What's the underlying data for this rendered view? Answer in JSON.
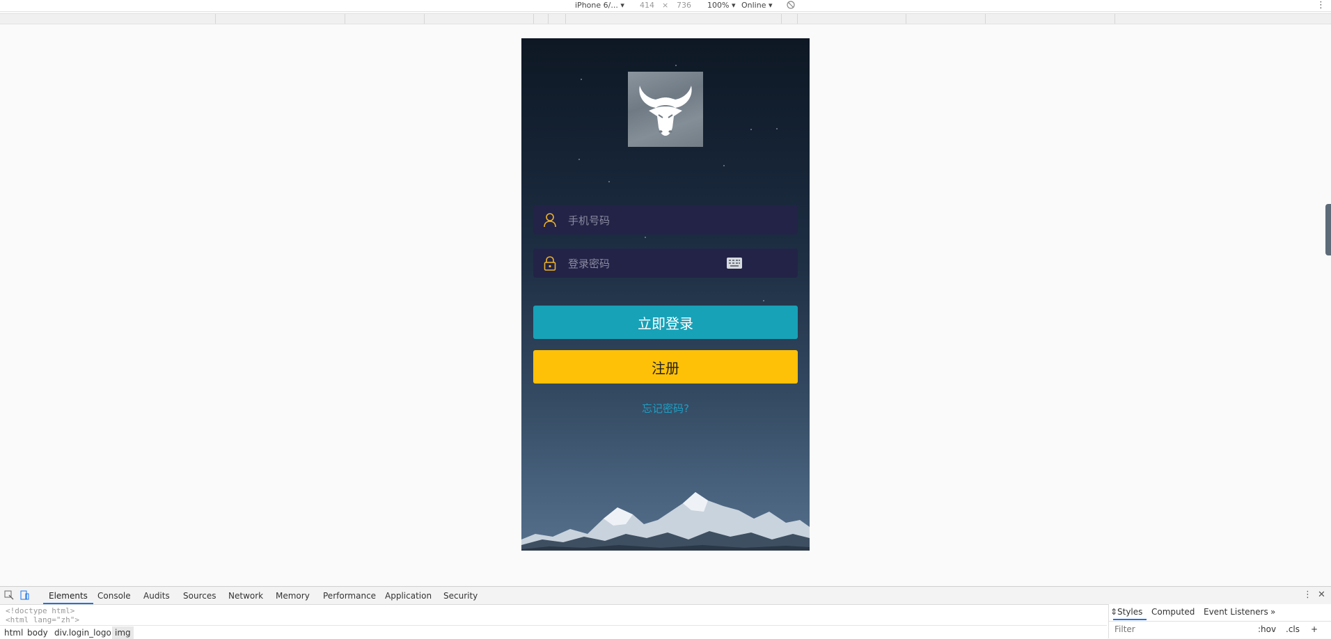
{
  "device_toolbar": {
    "device": "iPhone 6/...",
    "width": "414",
    "times": "×",
    "height": "736",
    "zoom": "100%",
    "throttle": "Online",
    "more_icon": "vertical-dots-icon",
    "rotate_icon": "rotate-icon"
  },
  "login": {
    "phone_placeholder": "手机号码",
    "password_placeholder": "登录密码",
    "login_button": "立即登录",
    "register_button": "注册",
    "forgot_link": "忘记密码?",
    "colors": {
      "login": "#17a2b8",
      "register": "#ffc107",
      "field_bg": "#232347",
      "icon": "#f0b429",
      "link": "#1e9fc4"
    }
  },
  "devtools": {
    "tabs": [
      "Elements",
      "Console",
      "Audits",
      "Sources",
      "Network",
      "Memory",
      "Performance",
      "Application",
      "Security"
    ],
    "active_tab": "Elements",
    "code_lines": [
      "<!doctype html>",
      "<html lang=\"zh\">"
    ],
    "breadcrumbs": [
      "html",
      "body",
      "div.login_logo",
      "img"
    ],
    "styles_tabs": [
      "Styles",
      "Computed",
      "Event Listeners"
    ],
    "more_tabs": "»",
    "filter_placeholder": "Filter",
    "hov": ":hov",
    "cls": ".cls",
    "plus": "+"
  }
}
